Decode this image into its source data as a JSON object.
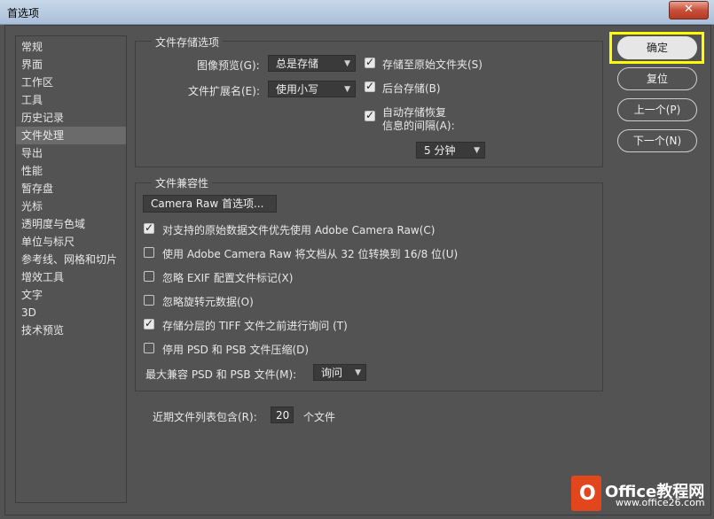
{
  "window": {
    "title": "首选项",
    "close_glyph": "✕"
  },
  "sidebar": {
    "items": [
      {
        "label": "常规"
      },
      {
        "label": "界面"
      },
      {
        "label": "工作区"
      },
      {
        "label": "工具"
      },
      {
        "label": "历史记录"
      },
      {
        "label": "文件处理"
      },
      {
        "label": "导出"
      },
      {
        "label": "性能"
      },
      {
        "label": "暂存盘"
      },
      {
        "label": "光标"
      },
      {
        "label": "透明度与色域"
      },
      {
        "label": "单位与标尺"
      },
      {
        "label": "参考线、网格和切片"
      },
      {
        "label": "增效工具"
      },
      {
        "label": "文字"
      },
      {
        "label": "3D"
      },
      {
        "label": "技术预览"
      }
    ],
    "selected_index": 5
  },
  "file_save": {
    "title": "文件存储选项",
    "image_preview_label": "图像预览(G):",
    "image_preview_value": "总是存储",
    "file_ext_label": "文件扩展名(E):",
    "file_ext_value": "使用小写",
    "save_original_folder": "存储至原始文件夹(S)",
    "background_save": "后台存储(B)",
    "auto_save_line1": "自动存储恢复",
    "auto_save_line2": "信息的间隔(A):",
    "interval_value": "5 分钟",
    "save_original_folder_checked": true,
    "background_save_checked": true,
    "auto_save_checked": true
  },
  "compat": {
    "title": "文件兼容性",
    "camera_raw_button": "Camera Raw 首选项...",
    "options": [
      {
        "label": "对支持的原始数据文件优先使用 Adobe Camera Raw(C)",
        "checked": true
      },
      {
        "label": "使用 Adobe Camera Raw 将文档从 32 位转换到 16/8 位(U)",
        "checked": false
      },
      {
        "label": "忽略 EXIF 配置文件标记(X)",
        "checked": false
      },
      {
        "label": "忽略旋转元数据(O)",
        "checked": false
      },
      {
        "label": "存储分层的 TIFF 文件之前进行询问 (T)",
        "checked": true
      },
      {
        "label": "停用 PSD 和 PSB 文件压缩(D)",
        "checked": false
      }
    ],
    "max_compat_label": "最大兼容 PSD 和 PSB 文件(M):",
    "max_compat_value": "询问"
  },
  "recent": {
    "label": "近期文件列表包含(R):",
    "value": "20",
    "suffix": "个文件"
  },
  "buttons": {
    "ok": "确定",
    "reset": "复位",
    "prev": "上一个(P)",
    "next": "下一个(N)"
  },
  "watermark": {
    "line1": "Office教程网",
    "line2": "www.office26.com",
    "logo_glyph": "O"
  },
  "colors": {
    "background": "#535353",
    "focus_ring": "#ffff00",
    "watermark_logo": "#e2461c"
  }
}
